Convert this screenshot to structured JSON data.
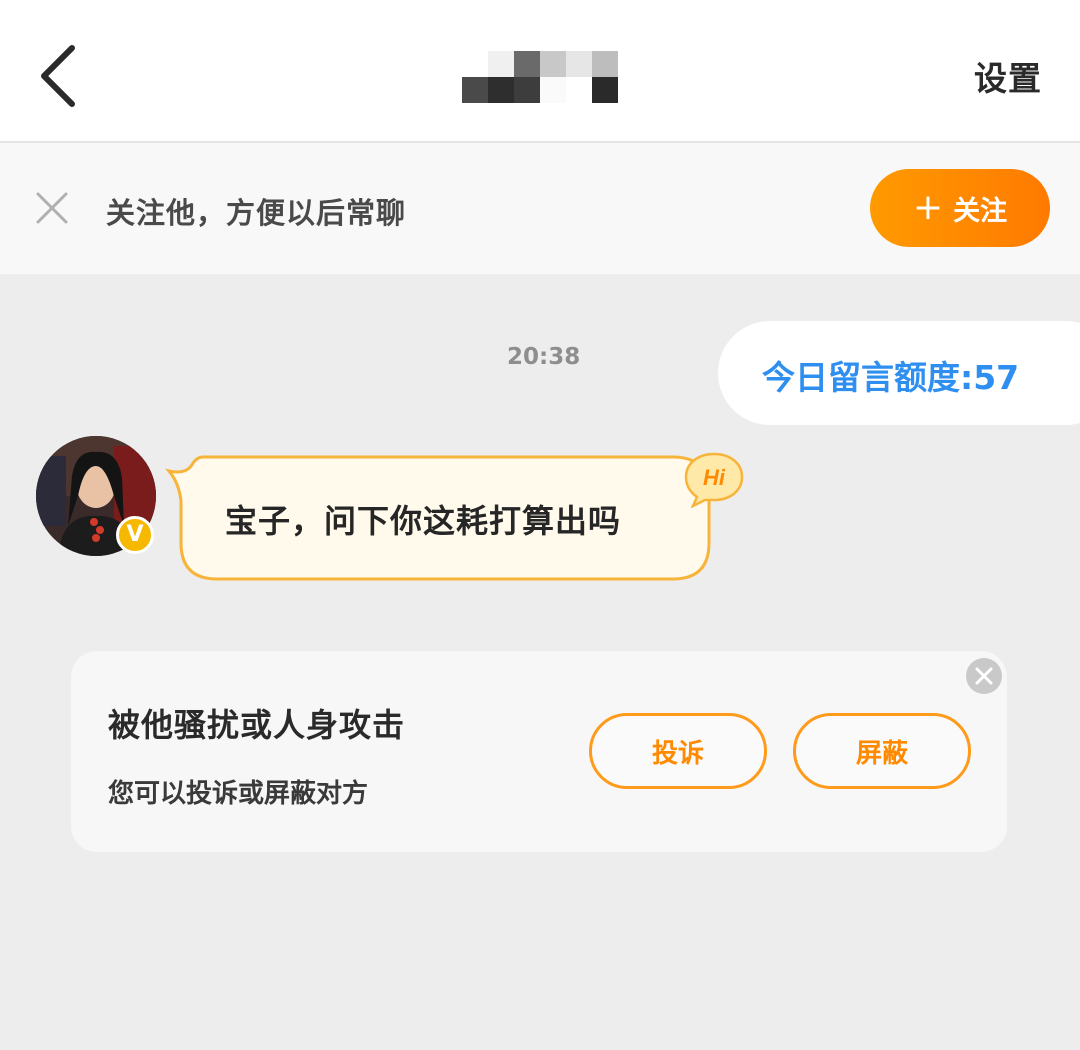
{
  "header": {
    "settings_label": "设置"
  },
  "follow_bar": {
    "tip": "关注他，方便以后常聊",
    "follow_button_label": "关注"
  },
  "chat": {
    "timestamp": "20:38",
    "quota_text": "今日留言额度:57",
    "messages": [
      {
        "text": "宝子，问下你这耗打算出吗",
        "badge": "Hi",
        "verified_badge": "V"
      }
    ]
  },
  "report_card": {
    "title": "被他骚扰或人身攻击",
    "subtitle": "您可以投诉或屏蔽对方",
    "report_button": "投诉",
    "block_button": "屏蔽"
  },
  "icons": [
    "back-icon",
    "close-icon",
    "plus-icon",
    "verified-icon",
    "hi-icon",
    "card-close-icon"
  ],
  "colors": {
    "accent_orange": "#ff8a00",
    "quota_blue": "#2f8ff0",
    "bubble_fill": "#fffaeb",
    "bubble_border": "#f7b43a",
    "badge_gold": "#f6b800"
  }
}
